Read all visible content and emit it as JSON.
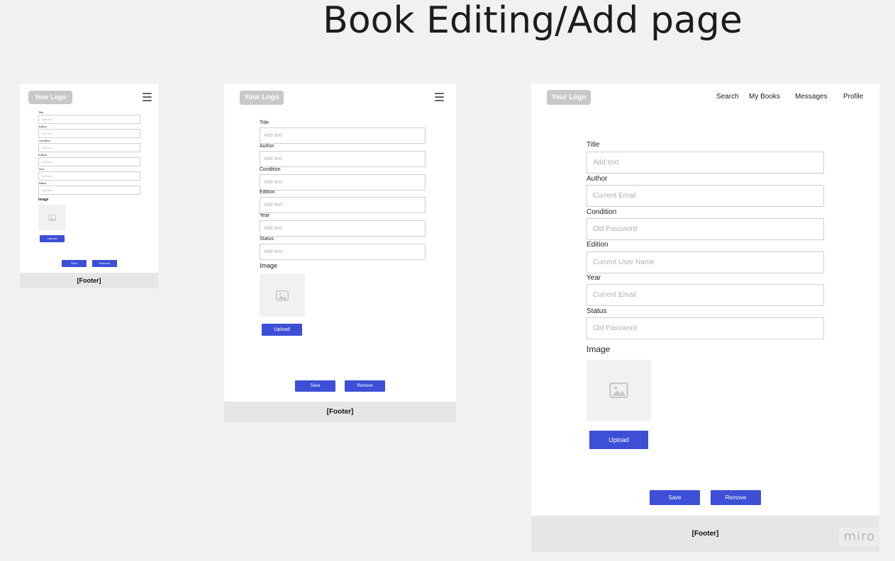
{
  "board": {
    "title": "Book Editing/Add page",
    "watermark": "miro"
  },
  "colors": {
    "accent": "#3d4fd6",
    "logo": "#c8c8c8",
    "footer": "#e6e6e6",
    "background": "#f1f1f1"
  },
  "header": {
    "logo": "Your Logo",
    "menu_icon": "hamburger-icon"
  },
  "desktop_nav": [
    "Search",
    "My Books",
    "Messages",
    "Profile"
  ],
  "image_section": {
    "label": "Image",
    "icon": "image-icon"
  },
  "actions": {
    "upload": "Upload",
    "save": "Save",
    "remove": "Remove"
  },
  "footer": "[Footer]",
  "mobile_form": {
    "fields": [
      {
        "label": "Title",
        "placeholder": "Add text"
      },
      {
        "label": "Author",
        "placeholder": "Add text"
      },
      {
        "label": "Condition",
        "placeholder": "Add text"
      },
      {
        "label": "Edition",
        "placeholder": "Add text"
      },
      {
        "label": "Year",
        "placeholder": "Add text"
      },
      {
        "label": "Status",
        "placeholder": "Add text"
      }
    ]
  },
  "tablet_form": {
    "fields": [
      {
        "label": "Title",
        "placeholder": "Add text"
      },
      {
        "label": "Author",
        "placeholder": "Add text"
      },
      {
        "label": "Condition",
        "placeholder": "Add text"
      },
      {
        "label": "Edition",
        "placeholder": "Add text"
      },
      {
        "label": "Year",
        "placeholder": "Add text"
      },
      {
        "label": "Status",
        "placeholder": "Add text"
      }
    ]
  },
  "desktop_form": {
    "fields": [
      {
        "label": "Title",
        "placeholder": "Add text"
      },
      {
        "label": "Author",
        "placeholder": "Current Email"
      },
      {
        "label": "Condition",
        "placeholder": "Old Password"
      },
      {
        "label": "Edition",
        "placeholder": "Current User Name"
      },
      {
        "label": "Year",
        "placeholder": "Current Email"
      },
      {
        "label": "Status",
        "placeholder": "Old Password"
      }
    ]
  }
}
